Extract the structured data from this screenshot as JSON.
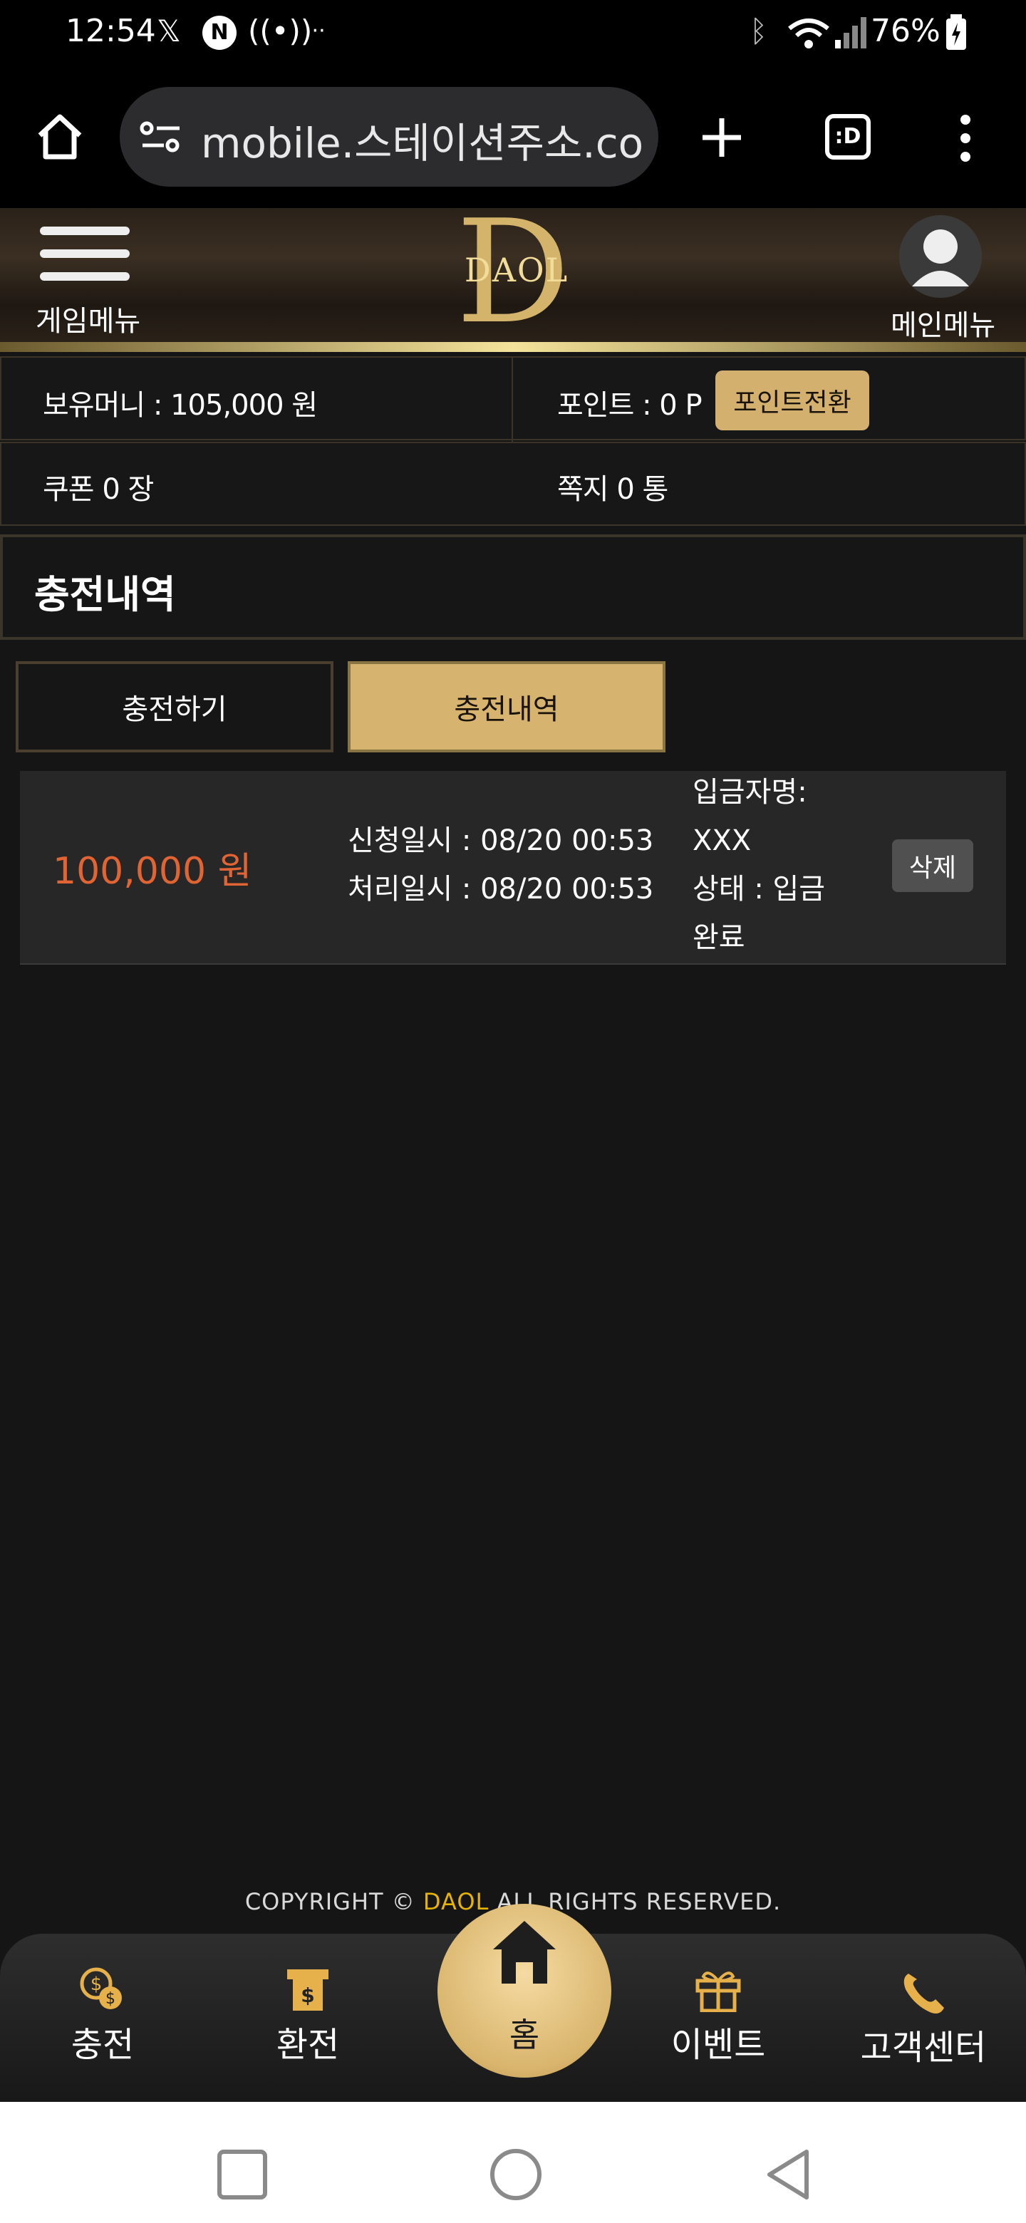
{
  "status_bar": {
    "time": "12:54",
    "battery": "76%",
    "icons": [
      "x-icon",
      "n-icon",
      "hotspot-icon",
      "more-icon",
      "bluetooth-icon",
      "wifi-icon",
      "signal-icon",
      "battery-icon"
    ]
  },
  "browser": {
    "url": "mobile.스테이션주소.com",
    "tab_label": ":D"
  },
  "header": {
    "game_menu_label": "게임메뉴",
    "main_menu_label": "메인메뉴",
    "logo_text": "DAOL",
    "logo_letter": "D"
  },
  "account": {
    "money_label": "보유머니 : 105,000 원",
    "point_label": "포인트 : 0 P",
    "point_convert_button": "포인트전환",
    "coupon_label": "쿠폰 0 장",
    "message_label": "쪽지 0 통"
  },
  "page": {
    "title": "충전내역",
    "tabs": [
      {
        "label": "충전하기",
        "active": false
      },
      {
        "label": "충전내역",
        "active": true
      }
    ]
  },
  "history": [
    {
      "amount": "100,000 원",
      "request_time": "신청일시 : 08/20 00:53",
      "process_time": "처리일시 : 08/20 00:53",
      "depositor_label": "입금자명:",
      "depositor": "XXX",
      "status_line1": "상태 : 입금",
      "status_line2": "완료",
      "delete_button": "삭제"
    }
  ],
  "footer": {
    "copyright_prefix": "COPYRIGHT © ",
    "brand": "DAOL",
    "copyright_suffix": " ALL RIGHTS RESERVED."
  },
  "bottom_nav": {
    "charge": "충전",
    "exchange": "환전",
    "home": "홈",
    "event": "이벤트",
    "support": "고객센터"
  },
  "colors": {
    "gold": "#d6b46f",
    "amount_orange": "#e06434",
    "brand_yellow": "#e6b400"
  }
}
